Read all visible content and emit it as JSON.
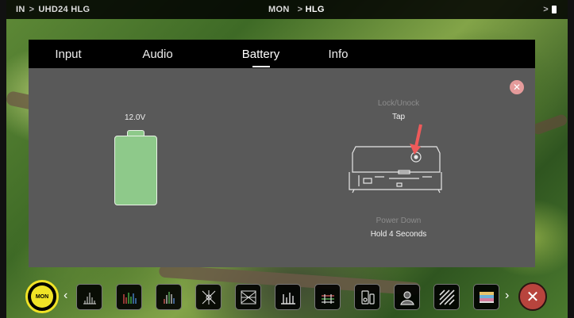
{
  "status_bar": {
    "input": "IN",
    "input_format": "UHD24 HLG",
    "mode": "MON",
    "mode_format": "HLG",
    "separator": ">"
  },
  "tabs": [
    {
      "label": "Input",
      "active": false
    },
    {
      "label": "Audio",
      "active": false
    },
    {
      "label": "Battery",
      "active": true
    },
    {
      "label": "Info",
      "active": false
    }
  ],
  "battery": {
    "voltage": "12.0V",
    "level": 1.0,
    "color": "#8ec98a"
  },
  "lock": {
    "title": "Lock/Unock",
    "value": "Tap"
  },
  "power_down": {
    "title": "Power Down",
    "value": "Hold 4 Seconds"
  },
  "toolbar": {
    "mon_label": "MON",
    "accent_color": "#f0e326",
    "tools": [
      "waveform-icon",
      "rgb-parade-icon",
      "histogram-icon",
      "vectorscope-icon",
      "cross-vectorscope-icon",
      "audio-meters-icon",
      "false-color-scale-icon",
      "monitor-settings-icon",
      "face-detect-icon",
      "zebra-icon",
      "color-bars-icon"
    ]
  }
}
